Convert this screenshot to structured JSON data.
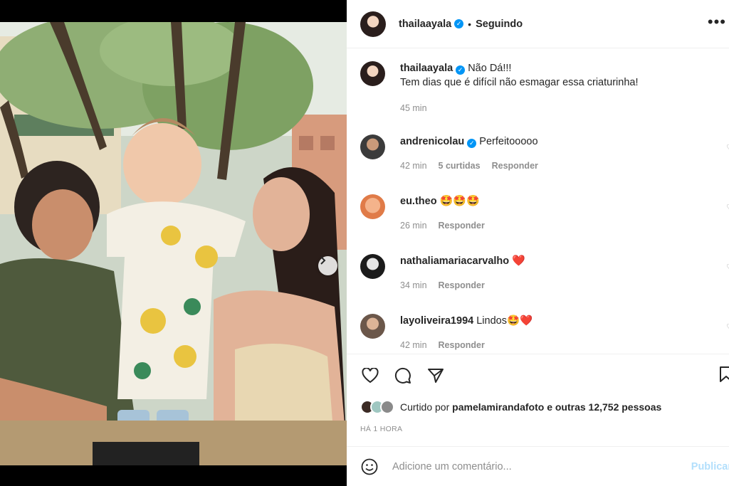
{
  "post": {
    "author": "thailaayala",
    "separator": "•",
    "follow_status": "Seguindo",
    "caption_line1": "Não Dá!!!",
    "caption_line2": "Tem dias que é difícil não esmagar essa criaturinha!",
    "caption_time": "45 min"
  },
  "comments": [
    {
      "user": "andrenicolau",
      "verified": true,
      "text": "Perfeitooooo",
      "time": "42 min",
      "likes": "5 curtidas",
      "reply": "Responder"
    },
    {
      "user": "eu.theo",
      "verified": false,
      "text": "🤩🤩🤩",
      "time": "26 min",
      "reply": "Responder"
    },
    {
      "user": "nathaliamariacarvalho",
      "verified": false,
      "text": "❤️",
      "time": "34 min",
      "reply": "Responder"
    },
    {
      "user": "layoliveira1994",
      "verified": false,
      "text": "Lindos🤩❤️",
      "time": "42 min",
      "reply": "Responder"
    }
  ],
  "likes": {
    "prefix": "Curtido por",
    "user": "pamelamirandafoto",
    "suffix": "e outras 12,752 pessoas"
  },
  "timeago": "HÁ 1 HORA",
  "composer": {
    "placeholder": "Adicione um comentário...",
    "publish": "Publicar"
  },
  "carousel": {
    "slides": 5,
    "active_index": 0
  },
  "icons": [
    "verified-badge-icon",
    "more-options-icon",
    "heart-icon",
    "comment-icon",
    "share-icon",
    "bookmark-icon",
    "emoji-icon",
    "next-arrow-icon"
  ],
  "colors": {
    "accent": "#0095f6",
    "muted": "#8e8e8e",
    "publish_disabled": "#b2dffc",
    "heart_red": "#ed1c2e"
  }
}
